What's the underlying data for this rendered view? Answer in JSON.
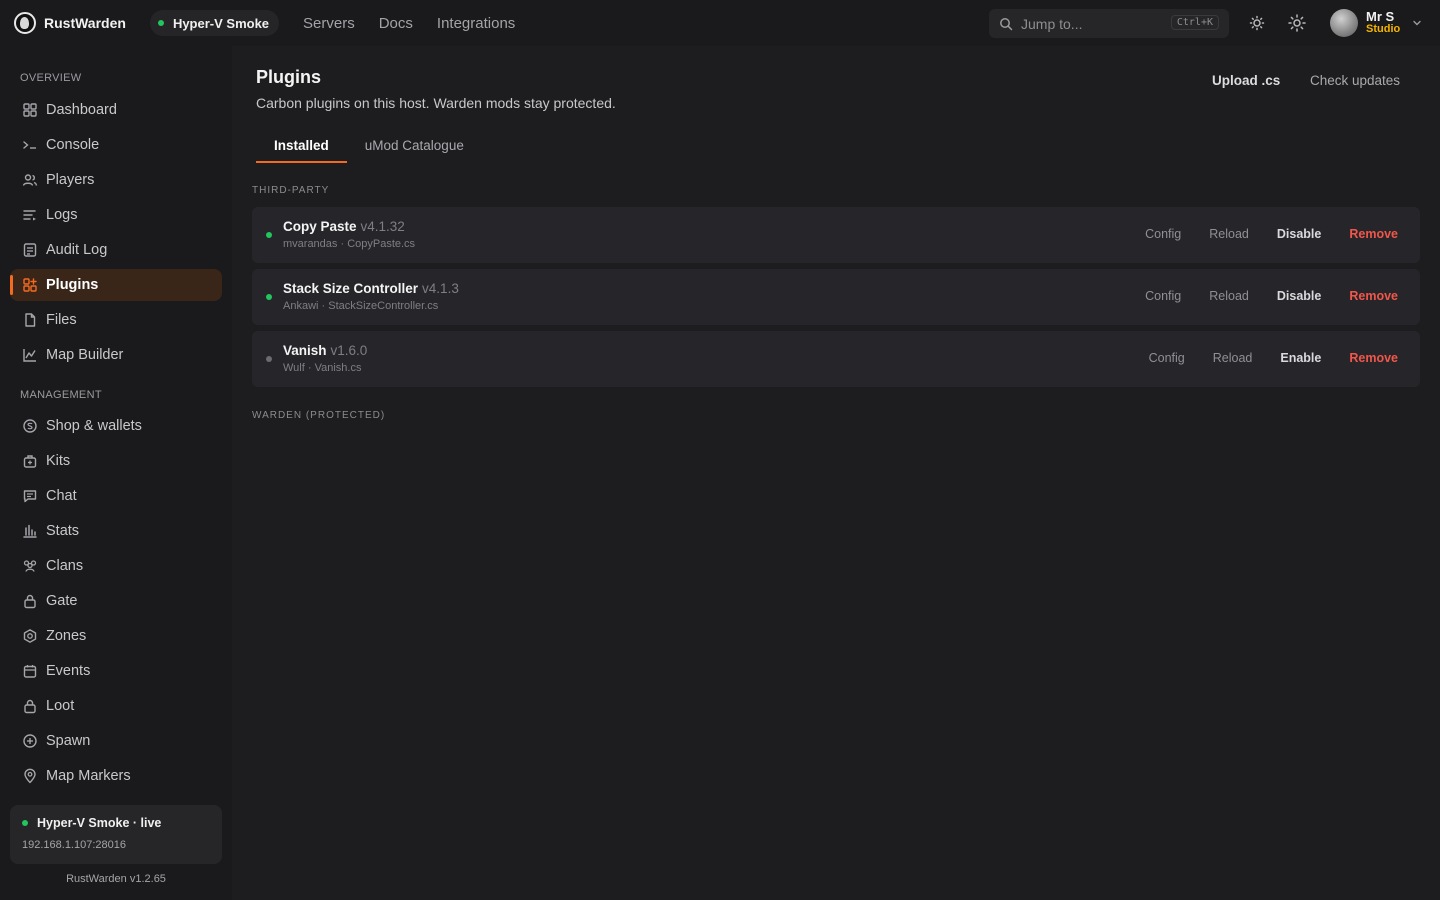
{
  "app": {
    "brand": "RustWarden",
    "server_pill": "Hyper-V Smoke",
    "nav": [
      "Servers",
      "Docs",
      "Integrations"
    ],
    "search_placeholder": "Jump to...",
    "search_shortcut": "Ctrl+K",
    "user": {
      "name": "Mr S",
      "role": "Studio"
    }
  },
  "sidebar": {
    "sections": [
      {
        "label": "OVERVIEW",
        "items": [
          {
            "label": "Dashboard",
            "icon": "grid-icon"
          },
          {
            "label": "Console",
            "icon": "terminal-icon"
          },
          {
            "label": "Players",
            "icon": "users-icon"
          },
          {
            "label": "Logs",
            "icon": "list-icon"
          },
          {
            "label": "Audit Log",
            "icon": "clipboard-icon"
          },
          {
            "label": "Plugins",
            "icon": "plugin-grid-icon",
            "active": true
          },
          {
            "label": "Files",
            "icon": "file-icon"
          },
          {
            "label": "Map Builder",
            "icon": "map-chart-icon"
          }
        ]
      },
      {
        "label": "MANAGEMENT",
        "items": [
          {
            "label": "Shop & wallets",
            "icon": "coin-icon"
          },
          {
            "label": "Kits",
            "icon": "kit-bag-icon"
          },
          {
            "label": "Chat",
            "icon": "chat-icon"
          },
          {
            "label": "Stats",
            "icon": "bar-chart-icon"
          },
          {
            "label": "Clans",
            "icon": "group-icon"
          },
          {
            "label": "Gate",
            "icon": "lock-icon"
          },
          {
            "label": "Zones",
            "icon": "zone-icon"
          },
          {
            "label": "Events",
            "icon": "calendar-icon"
          },
          {
            "label": "Loot",
            "icon": "loot-icon"
          },
          {
            "label": "Spawn",
            "icon": "plus-circle-icon"
          },
          {
            "label": "Map Markers",
            "icon": "pin-icon"
          }
        ]
      }
    ],
    "status": {
      "title": "Hyper-V Smoke · live",
      "address": "192.168.1.107:28016"
    },
    "version": "RustWarden v1.2.65"
  },
  "page": {
    "title": "Plugins",
    "subtitle": "Carbon plugins on this host. Warden mods stay protected.",
    "upload_label": "Upload .cs",
    "check_label": "Check updates",
    "tabs": [
      "Installed",
      "uMod Catalogue"
    ],
    "groups": {
      "third_party": "THIRD-PARTY",
      "warden": "WARDEN (PROTECTED)"
    },
    "plugins": [
      {
        "name": "Copy Paste",
        "version": "v4.1.32",
        "meta": "mvarandas · CopyPaste.cs",
        "enabled": true,
        "actions": {
          "config": "Config",
          "reload": "Reload",
          "toggle": "Disable",
          "remove": "Remove"
        }
      },
      {
        "name": "Stack Size Controller",
        "version": "v4.1.3",
        "meta": "Ankawi · StackSizeController.cs",
        "enabled": true,
        "actions": {
          "config": "Config",
          "reload": "Reload",
          "toggle": "Disable",
          "remove": "Remove"
        }
      },
      {
        "name": "Vanish",
        "version": "v1.6.0",
        "meta": "Wulf · Vanish.cs",
        "enabled": false,
        "actions": {
          "config": "Config",
          "reload": "Reload",
          "toggle": "Enable",
          "remove": "Remove"
        }
      }
    ]
  },
  "colors": {
    "accent": "#f36b21",
    "live": "#22c55e",
    "danger": "#f0564a",
    "role": "#f5b400"
  }
}
